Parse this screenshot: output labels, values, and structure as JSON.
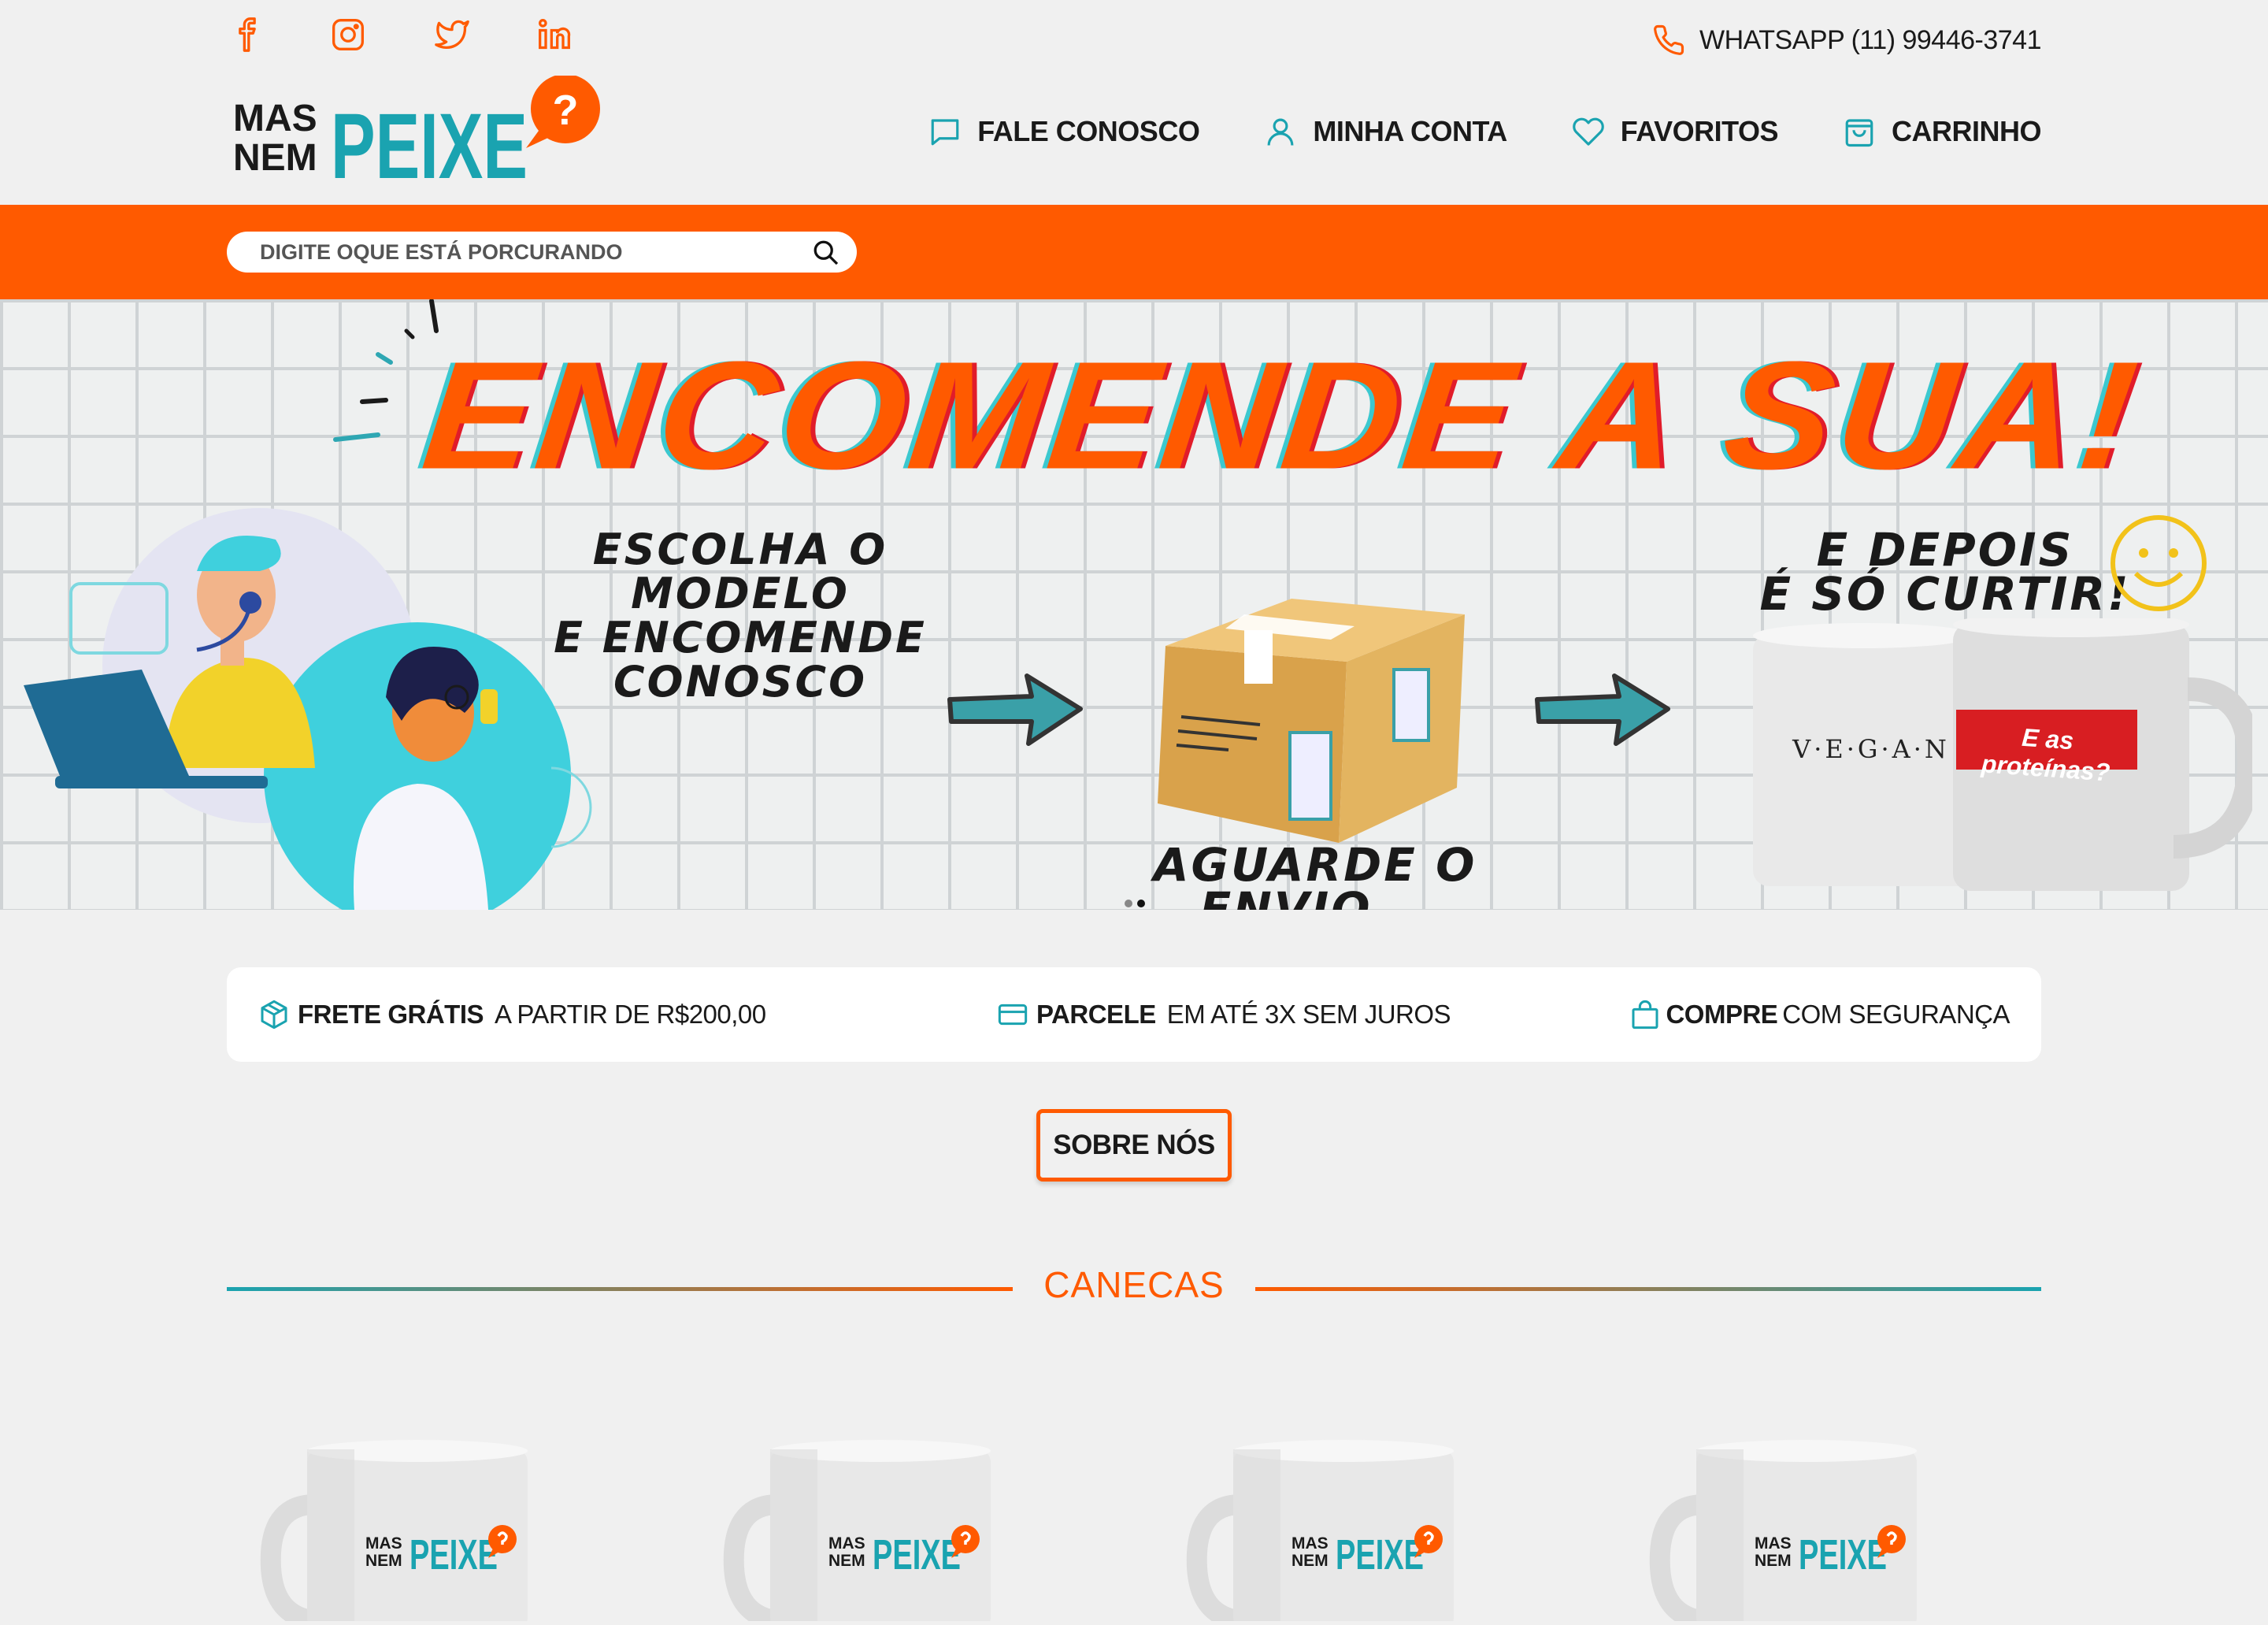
{
  "colors": {
    "accent": "#ff5a00",
    "teal": "#1aa3b0",
    "background": "#f0f0f0"
  },
  "social": [
    {
      "name": "facebook-icon"
    },
    {
      "name": "instagram-icon"
    },
    {
      "name": "twitter-icon"
    },
    {
      "name": "linkedin-icon"
    }
  ],
  "header": {
    "whatsapp": "WHATSAPP (11) 99446-3741",
    "logo": {
      "line1": "MAS",
      "line2": "NEM",
      "brand": "PEIXE",
      "badge": "?"
    },
    "nav": {
      "contact": "FALE CONOSCO",
      "account": "MINHA CONTA",
      "favorites": "FAVORITOS",
      "cart": "CARRINHO"
    }
  },
  "search": {
    "placeholder": "DIGITE OQUE ESTÁ PORCURANDO"
  },
  "banner": {
    "title": "ENCOMENDE A SUA!",
    "step1": "ESCOLHA O MODELO\nE ENCOMENDE\nCONOSCO",
    "step2": "AGUARDE O ENVIO...",
    "step3": "E DEPOIS\nÉ SÓ CURTIR!",
    "mug1_text": "V·E·G·A·N",
    "mug2_text": "E as proteínas?",
    "slides": 2,
    "active_slide": 2
  },
  "benefits": {
    "shipping_bold": "FRETE GRÁTIS",
    "shipping_text": "A PARTIR DE R$200,00",
    "installments_bold": "PARCELE",
    "installments_text": "EM ATÉ 3X SEM JUROS",
    "secure_bold": "COMPRE",
    "secure_text": "COM SEGURANÇA"
  },
  "about_button": "SOBRE NÓS",
  "section": {
    "title": "CANECAS"
  },
  "products": [
    {
      "logo_line1": "MAS",
      "logo_line2": "NEM",
      "logo_brand": "PEIXE"
    },
    {
      "logo_line1": "MAS",
      "logo_line2": "NEM",
      "logo_brand": "PEIXE"
    },
    {
      "logo_line1": "MAS",
      "logo_line2": "NEM",
      "logo_brand": "PEIXE"
    },
    {
      "logo_line1": "MAS",
      "logo_line2": "NEM",
      "logo_brand": "PEIXE"
    }
  ]
}
